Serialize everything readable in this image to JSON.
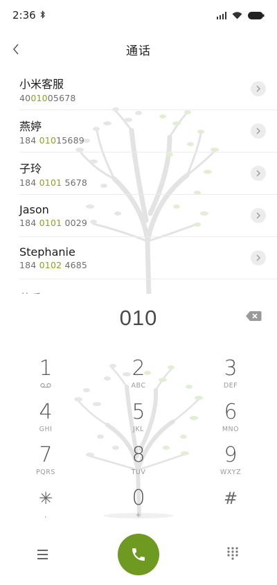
{
  "status_bar": {
    "time": "2:36"
  },
  "header": {
    "title": "通话"
  },
  "contacts": [
    {
      "name": "小米客服",
      "number_pre": "40",
      "number_hl": "010",
      "number_post": "05678"
    },
    {
      "name": "燕婷",
      "number_pre": "184 ",
      "number_hl": "010",
      "number_post": "15689"
    },
    {
      "name": "子玲",
      "number_pre": "184 ",
      "number_hl": "0101",
      "number_post": " 5678"
    },
    {
      "name": "Jason",
      "number_pre": "184 ",
      "number_hl": "0101",
      "number_post": " 0029"
    },
    {
      "name": "Stephanie",
      "number_pre": "184 ",
      "number_hl": "0102",
      "number_post": " 4685"
    },
    {
      "name": "芸香",
      "number_pre": "",
      "number_hl": "",
      "number_post": ""
    }
  ],
  "dial": {
    "number": "010"
  },
  "keypad": [
    {
      "digit": "1",
      "letters": ""
    },
    {
      "digit": "2",
      "letters": "ABC"
    },
    {
      "digit": "3",
      "letters": "DEF"
    },
    {
      "digit": "4",
      "letters": "GHI"
    },
    {
      "digit": "5",
      "letters": "JKL"
    },
    {
      "digit": "6",
      "letters": "MNO"
    },
    {
      "digit": "7",
      "letters": "PQRS"
    },
    {
      "digit": "8",
      "letters": "TUV"
    },
    {
      "digit": "9",
      "letters": "WXYZ"
    },
    {
      "digit": "✳",
      "letters": ","
    },
    {
      "digit": "0",
      "letters": "+"
    },
    {
      "digit": "#",
      "letters": ""
    }
  ],
  "colors": {
    "accent": "#6e9a22",
    "match_highlight": "#8ba123"
  },
  "icons": {
    "back": "chevron-left-icon",
    "detail": "chevron-right-icon",
    "backspace": "backspace-icon",
    "voicemail": "voicemail-icon",
    "menu": "menu-icon",
    "call": "phone-icon",
    "dialpad": "dialpad-icon"
  }
}
